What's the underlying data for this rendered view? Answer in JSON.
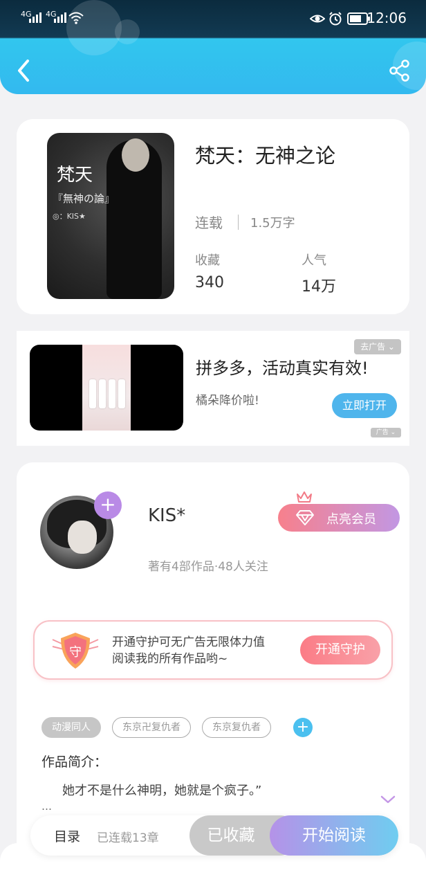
{
  "status_bar": {
    "signal1": "4G",
    "signal2": "4G",
    "time": "12:06",
    "icons": [
      "signal-icon",
      "wifi-icon",
      "eye-icon",
      "alarm-icon",
      "battery-icon"
    ]
  },
  "header": {
    "back_icon": "chevron-left-icon",
    "share_icon": "share-icon",
    "gradient": [
      "#32c6ee",
      "#33b9ef"
    ]
  },
  "book": {
    "cover_title_big": "梵天",
    "cover_title_small": "『無神の論』",
    "cover_author": "◎：KIS★",
    "title": "梵天：无神之论",
    "status": "连载",
    "word_count": "1.5万字",
    "stats": [
      {
        "label": "收藏",
        "value": "340"
      },
      {
        "label": "人气",
        "value": "14万"
      }
    ]
  },
  "ad": {
    "title": "拼多多，活动真实有效!",
    "subtitle": "橘朵降价啦!",
    "button": "立即打开",
    "close_label": "去广告 ⌄",
    "ad_mark": "广告 ⌄",
    "button_color": "#4fb5ec"
  },
  "author": {
    "name": "KIS*",
    "follow_symbol": "+",
    "stats": "著有4部作品·48人关注",
    "vip_button": "点亮会员",
    "guard": {
      "line1": "开通守护可无广告无限体力值",
      "line2": "阅读我的所有作品哟~",
      "shield_char": "守",
      "button": "开通守护"
    },
    "tags": [
      "动漫同人",
      "东京卍复仇者",
      "东京复仇者"
    ],
    "tag_add_symbol": "+",
    "intro_label": "作品简介：",
    "intro_text": "她才不是什么神明，她就是个疯子。”",
    "intro_more": "…"
  },
  "bottom_bar": {
    "catalog": "目录",
    "chapters": "已连载13章",
    "collected": "已收藏",
    "read": "开始阅读",
    "read_gradient": [
      "#b592e8",
      "#6fcdf0"
    ]
  }
}
